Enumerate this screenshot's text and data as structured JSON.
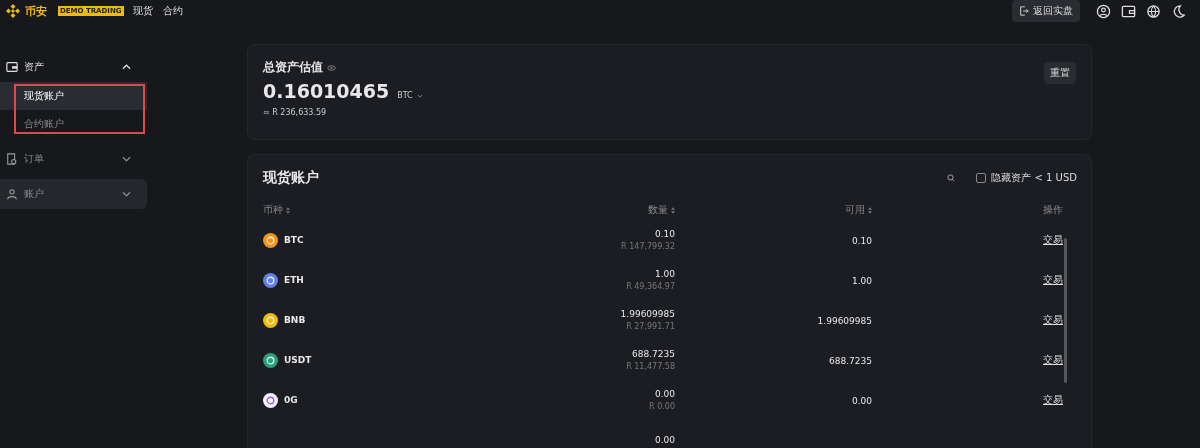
{
  "top_bar": {
    "logo_text": "币安",
    "badge": "DEMO TRADING",
    "nav": [
      "现货",
      "合约"
    ],
    "return_button": "返回实盘"
  },
  "sidebar": {
    "items": [
      {
        "label": "资产",
        "expanded": true,
        "selected": false,
        "children": [
          {
            "label": "现货账户",
            "selected": true
          },
          {
            "label": "合约账户",
            "selected": false
          }
        ]
      },
      {
        "label": "订单",
        "expanded": false,
        "selected": false
      },
      {
        "label": "账户",
        "expanded": false,
        "selected": true
      }
    ]
  },
  "summary": {
    "title": "总资产估值",
    "value": "0.16010465",
    "unit": "BTC",
    "fiat": "≈ R 236,633.59",
    "reset_button": "重置"
  },
  "spot": {
    "title": "现货账户",
    "hide_small": {
      "label": "隐藏资产 < 1 USD",
      "checked": false
    },
    "table": {
      "columns": [
        "币种",
        "数量",
        "可用",
        "操作"
      ],
      "rows": [
        {
          "coin": "BTC",
          "color": "#f7931a",
          "amount": "0.10",
          "fiat": "R 147,799.32",
          "available": "0.10",
          "action": "交易"
        },
        {
          "coin": "ETH",
          "color": "#627eea",
          "amount": "1.00",
          "fiat": "R 49,364.97",
          "available": "1.00",
          "action": "交易"
        },
        {
          "coin": "BNB",
          "color": "#f0b90b",
          "amount": "1.99609985",
          "fiat": "R 27,991.71",
          "available": "1.99609985",
          "action": "交易"
        },
        {
          "coin": "USDT",
          "color": "#26a17b",
          "amount": "688.7235",
          "fiat": "R 11,477.58",
          "available": "688.7235",
          "action": "交易"
        },
        {
          "coin": "0G",
          "color": "#f5f0ff",
          "amount": "0.00",
          "fiat": "R 0.00",
          "available": "0.00",
          "action": "交易"
        },
        {
          "amount": "0.00"
        }
      ]
    }
  }
}
